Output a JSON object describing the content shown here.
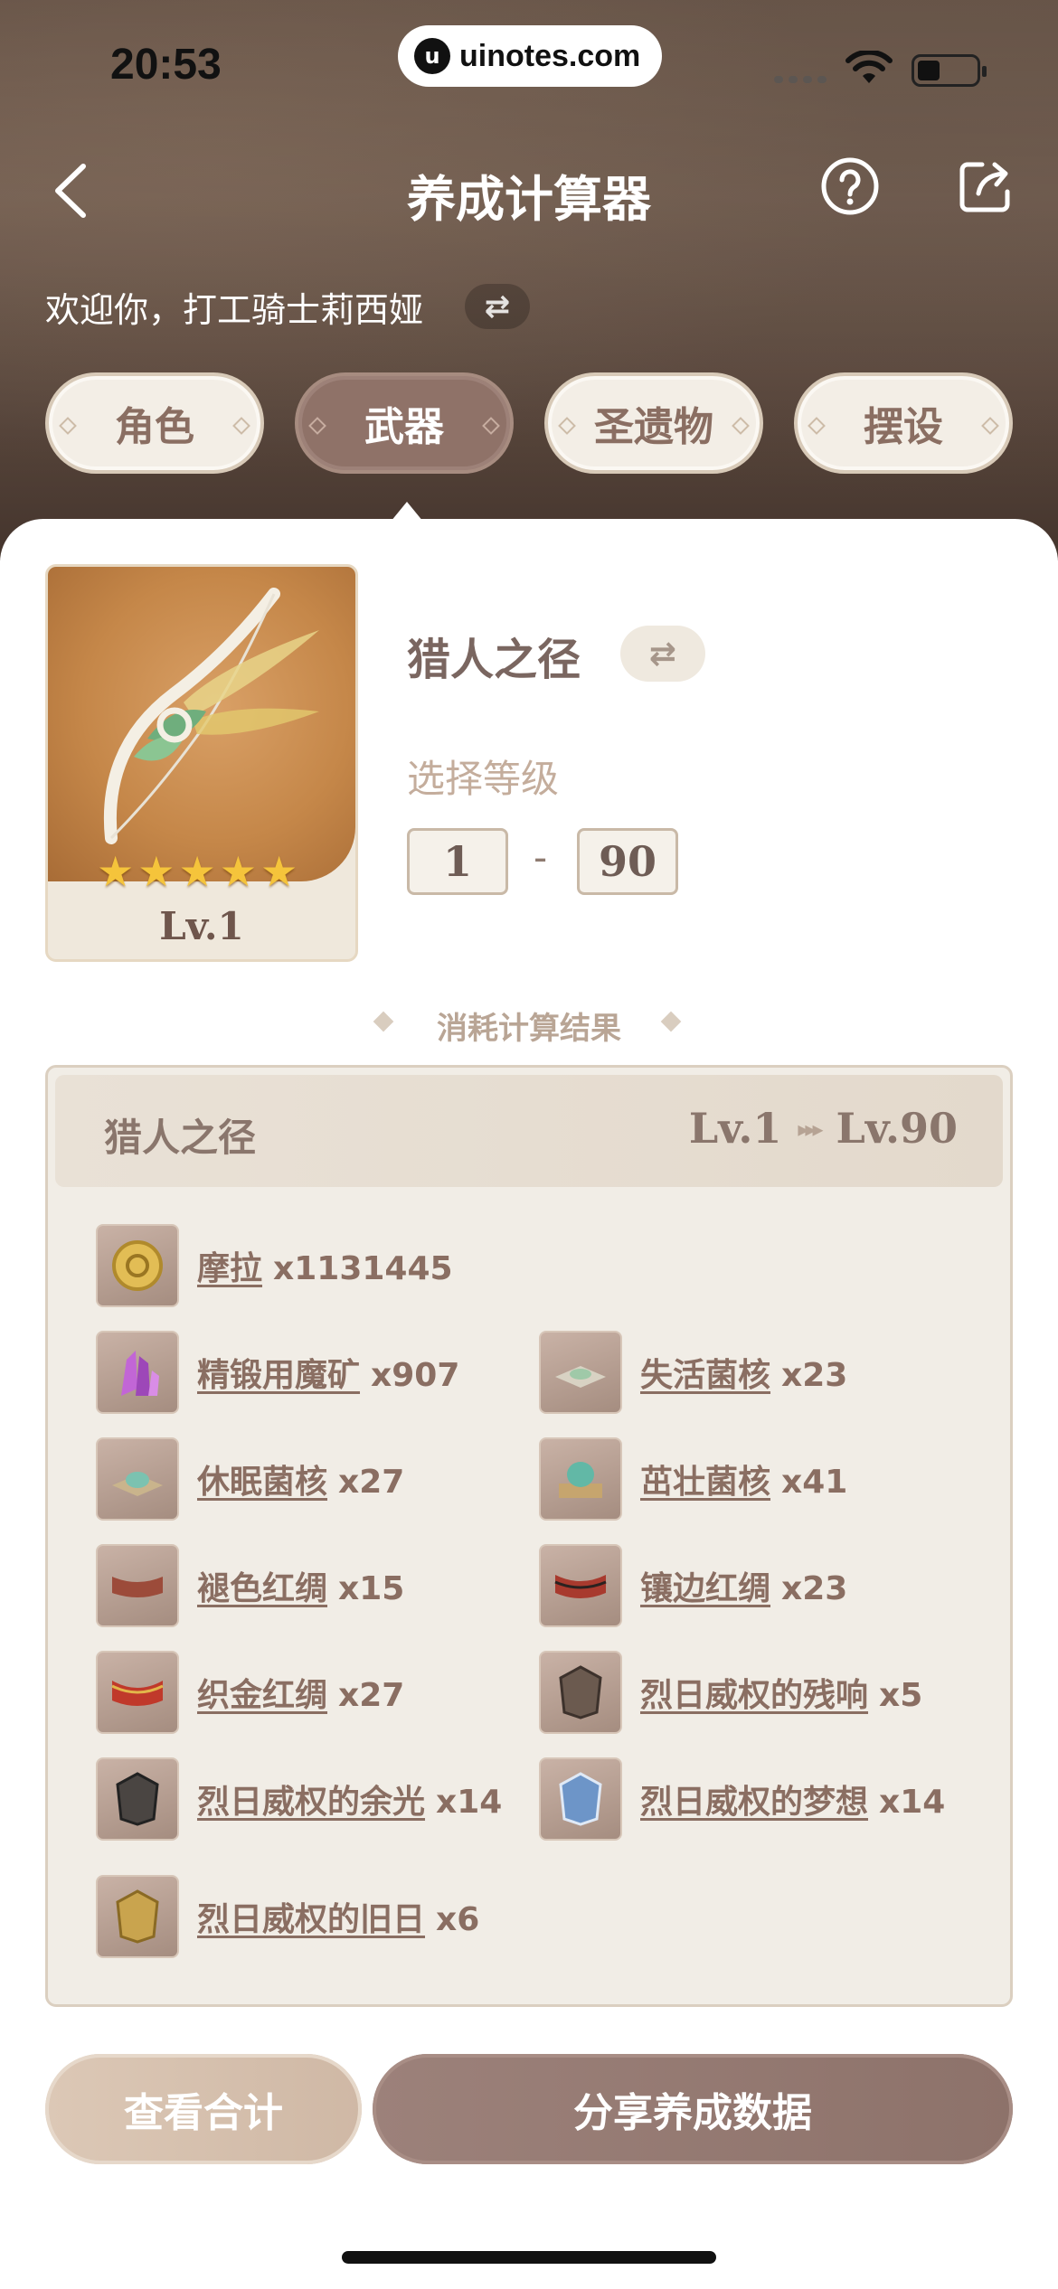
{
  "status_bar": {
    "time": "20:53",
    "url": "uinotes.com"
  },
  "nav": {
    "title": "养成计算器"
  },
  "welcome": {
    "text": "欢迎你，打工骑士莉西娅",
    "switch_glyph": "⇄"
  },
  "tabs": [
    {
      "label": "角色",
      "active": false
    },
    {
      "label": "武器",
      "active": true
    },
    {
      "label": "圣遗物",
      "active": false
    },
    {
      "label": "摆设",
      "active": false
    }
  ],
  "weapon": {
    "name": "猎人之径",
    "level_badge": "Lv.1",
    "stars": 5,
    "switch_glyph": "⇄",
    "select_level_label": "选择等级",
    "level_from": "1",
    "level_to": "90",
    "level_dash": "-"
  },
  "result": {
    "section_title": "消耗计算结果",
    "header_name": "猎人之径",
    "from_level": "Lv.1",
    "to_level": "Lv.90",
    "arrows": "▸▸▸",
    "materials": [
      {
        "name": "摩拉",
        "count": "x1131445",
        "icon": "mora-coin-icon",
        "color": "#d8b449"
      },
      {
        "name": "精锻用魔矿",
        "count": "x907",
        "icon": "mystic-ore-icon",
        "color": "#b257c9"
      },
      {
        "name": "失活菌核",
        "count": "x23",
        "icon": "inactivated-fungal-nucleus-icon",
        "color": "#9fc9a8"
      },
      {
        "name": "休眠菌核",
        "count": "x27",
        "icon": "dormant-fungal-nucleus-icon",
        "color": "#7bc2b0"
      },
      {
        "name": "茁壮菌核",
        "count": "x41",
        "icon": "robust-fungal-nucleus-icon",
        "color": "#62b8a6"
      },
      {
        "name": "褪色红绸",
        "count": "x15",
        "icon": "faded-red-satin-icon",
        "color": "#9c4b3a"
      },
      {
        "name": "镶边红绸",
        "count": "x23",
        "icon": "trimmed-red-silk-icon",
        "color": "#a83a2e"
      },
      {
        "name": "织金红绸",
        "count": "x27",
        "icon": "rich-red-brocade-icon",
        "color": "#c0392b"
      },
      {
        "name": "烈日威权的残响",
        "count": "x5",
        "icon": "echo-of-scorching-might-icon",
        "color": "#6b5a4f"
      },
      {
        "name": "烈日威权的余光",
        "count": "x14",
        "icon": "remnant-glow-of-scorching-might-icon",
        "color": "#4a4542"
      },
      {
        "name": "烈日威权的梦想",
        "count": "x14",
        "icon": "dream-of-scorching-might-icon",
        "color": "#6d95c8"
      },
      {
        "name": "烈日威权的旧日",
        "count": "x6",
        "icon": "olden-days-of-scorching-might-icon",
        "color": "#c9a44e"
      }
    ]
  },
  "buttons": {
    "view_total": "查看合计",
    "share": "分享养成数据"
  }
}
